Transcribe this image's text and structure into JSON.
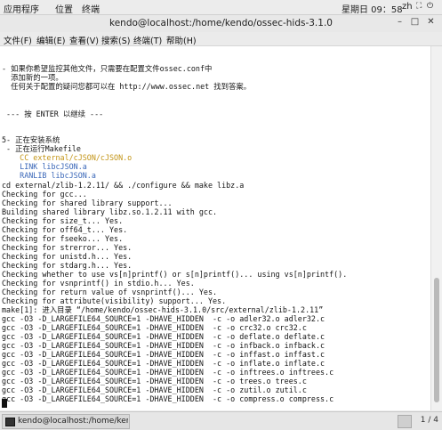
{
  "topbar": {
    "apps": "应用程序",
    "places": "位置",
    "terminal": "终端",
    "clock": "星期日 09：58",
    "lang": "zh"
  },
  "window": {
    "title": "kendo@localhost:/home/kendo/ossec-hids-3.1.0",
    "minimize": "–",
    "maximize": "□",
    "close": "✕"
  },
  "menu": [
    "文件(F)",
    "编辑(E)",
    "查看(V)",
    "搜索(S)",
    "终端(T)",
    "帮助(H)"
  ],
  "terminal": {
    "lines": [
      {
        "text": "- 如果你希望监控其他文件，只需要在配置文件ossec.conf中",
        "color": "#141414"
      },
      {
        "text": "  添加新的一项。",
        "color": "#141414"
      },
      {
        "text": "  任何关于配置的疑问您都可以在 http://www.ossec.net 找到答案。",
        "color": "#141414"
      },
      {
        "text": "",
        "color": "#141414"
      },
      {
        "text": "",
        "color": "#141414"
      },
      {
        "text": " --- 按 ENTER 以继续 ---",
        "color": "#141414"
      },
      {
        "text": "",
        "color": "#141414"
      },
      {
        "text": "",
        "color": "#141414"
      },
      {
        "text": "5- 正在安装系统",
        "color": "#141414"
      },
      {
        "text": " - 正在运行Makefile",
        "color": "#141414"
      },
      {
        "text": "    CC external/cJSON/cJSON.o",
        "color": "#c39415"
      },
      {
        "text": "    LINK libcJSON.a",
        "color": "#3a67b8"
      },
      {
        "text": "    RANLIB libcJSON.a",
        "color": "#3a67b8"
      },
      {
        "text": "cd external/zlib-1.2.11/ && ./configure && make libz.a",
        "color": "#141414"
      },
      {
        "text": "Checking for gcc...",
        "color": "#141414"
      },
      {
        "text": "Checking for shared library support...",
        "color": "#141414"
      },
      {
        "text": "Building shared library libz.so.1.2.11 with gcc.",
        "color": "#141414"
      },
      {
        "text": "Checking for size_t... Yes.",
        "color": "#141414"
      },
      {
        "text": "Checking for off64_t... Yes.",
        "color": "#141414"
      },
      {
        "text": "Checking for fseeko... Yes.",
        "color": "#141414"
      },
      {
        "text": "Checking for strerror... Yes.",
        "color": "#141414"
      },
      {
        "text": "Checking for unistd.h... Yes.",
        "color": "#141414"
      },
      {
        "text": "Checking for stdarg.h... Yes.",
        "color": "#141414"
      },
      {
        "text": "Checking whether to use vs[n]printf() or s[n]printf()... using vs[n]printf().",
        "color": "#141414"
      },
      {
        "text": "Checking for vsnprintf() in stdio.h... Yes.",
        "color": "#141414"
      },
      {
        "text": "Checking for return value of vsnprintf()... Yes.",
        "color": "#141414"
      },
      {
        "text": "Checking for attribute(visibility) support... Yes.",
        "color": "#141414"
      },
      {
        "text": "make[1]: 进入目录 “/home/kendo/ossec-hids-3.1.0/src/external/zlib-1.2.11”",
        "color": "#141414"
      },
      {
        "text": "gcc -O3 -D_LARGEFILE64_SOURCE=1 -DHAVE_HIDDEN  -c -o adler32.o adler32.c",
        "color": "#141414"
      },
      {
        "text": "gcc -O3 -D_LARGEFILE64_SOURCE=1 -DHAVE_HIDDEN  -c -o crc32.o crc32.c",
        "color": "#141414"
      },
      {
        "text": "gcc -O3 -D_LARGEFILE64_SOURCE=1 -DHAVE_HIDDEN  -c -o deflate.o deflate.c",
        "color": "#141414"
      },
      {
        "text": "gcc -O3 -D_LARGEFILE64_SOURCE=1 -DHAVE_HIDDEN  -c -o infback.o infback.c",
        "color": "#141414"
      },
      {
        "text": "gcc -O3 -D_LARGEFILE64_SOURCE=1 -DHAVE_HIDDEN  -c -o inffast.o inffast.c",
        "color": "#141414"
      },
      {
        "text": "gcc -O3 -D_LARGEFILE64_SOURCE=1 -DHAVE_HIDDEN  -c -o inflate.o inflate.c",
        "color": "#141414"
      },
      {
        "text": "gcc -O3 -D_LARGEFILE64_SOURCE=1 -DHAVE_HIDDEN  -c -o inftrees.o inftrees.c",
        "color": "#141414"
      },
      {
        "text": "gcc -O3 -D_LARGEFILE64_SOURCE=1 -DHAVE_HIDDEN  -c -o trees.o trees.c",
        "color": "#141414"
      },
      {
        "text": "gcc -O3 -D_LARGEFILE64_SOURCE=1 -DHAVE_HIDDEN  -c -o zutil.o zutil.c",
        "color": "#141414"
      },
      {
        "text": "gcc -O3 -D_LARGEFILE64_SOURCE=1 -DHAVE_HIDDEN  -c -o compress.o compress.c",
        "color": "#141414"
      }
    ]
  },
  "taskbar": {
    "task_label": "kendo@localhost:/home/kendo/oss...",
    "pager": "1 / 4"
  }
}
